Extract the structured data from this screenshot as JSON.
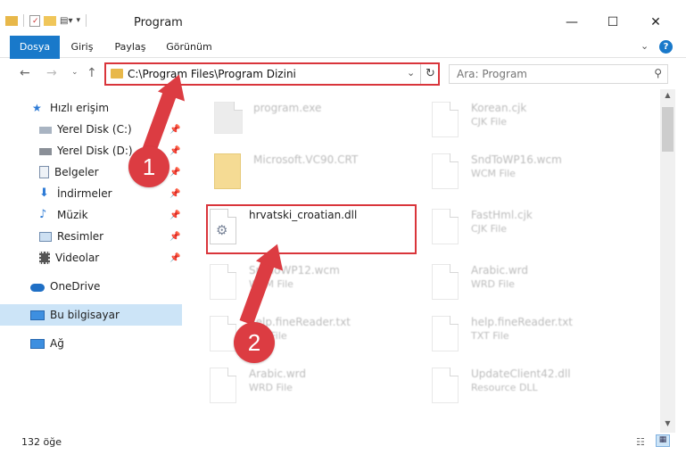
{
  "window": {
    "title": "Program"
  },
  "ribbon": {
    "tabs": [
      "Dosya",
      "Giriş",
      "Paylaş",
      "Görünüm"
    ],
    "help": "?"
  },
  "navbar": {
    "address": "C:\\Program Files\\Program Dizini",
    "search_placeholder": "Ara: Program"
  },
  "sidebar": {
    "items": [
      {
        "label": "Hızlı erişim",
        "icon": "star-icon"
      },
      {
        "label": "Yerel Disk (C:)",
        "icon": "drive-icon"
      },
      {
        "label": "Yerel Disk (D:)",
        "icon": "drive-icon"
      },
      {
        "label": "Belgeler",
        "icon": "documents-icon"
      },
      {
        "label": "İndirmeler",
        "icon": "download-icon"
      },
      {
        "label": "Müzik",
        "icon": "music-icon"
      },
      {
        "label": "Resimler",
        "icon": "pictures-icon"
      },
      {
        "label": "Videolar",
        "icon": "video-icon"
      },
      {
        "label": "OneDrive",
        "icon": "cloud-icon"
      },
      {
        "label": "Bu bilgisayar",
        "icon": "computer-icon"
      },
      {
        "label": "Ağ",
        "icon": "network-icon"
      }
    ]
  },
  "files": [
    {
      "name": "program.exe",
      "type": ""
    },
    {
      "name": "Korean.cjk",
      "type": "CJK File"
    },
    {
      "name": "Microsoft.VC90.CRT",
      "type": ""
    },
    {
      "name": "SndToWP16.wcm",
      "type": "WCM File"
    },
    {
      "name": "hrvatski_croatian.dll",
      "type": ""
    },
    {
      "name": "FastHml.cjk",
      "type": "CJK File"
    },
    {
      "name": "SndToWP12.wcm",
      "type": "WCM File"
    },
    {
      "name": "Arabic.wrd",
      "type": "WRD File"
    },
    {
      "name": "help.fineReader.txt",
      "type": "TXT File"
    },
    {
      "name": "help.fineReader.txt",
      "type": "TXT File"
    },
    {
      "name": "Arabic.wrd",
      "type": "WRD File"
    },
    {
      "name": "UpdateClient42.dll",
      "type": "Resource DLL"
    }
  ],
  "status": {
    "count": "132 öğe"
  },
  "annotations": {
    "badge1": "1",
    "badge2": "2",
    "color": "#dc3c42"
  }
}
